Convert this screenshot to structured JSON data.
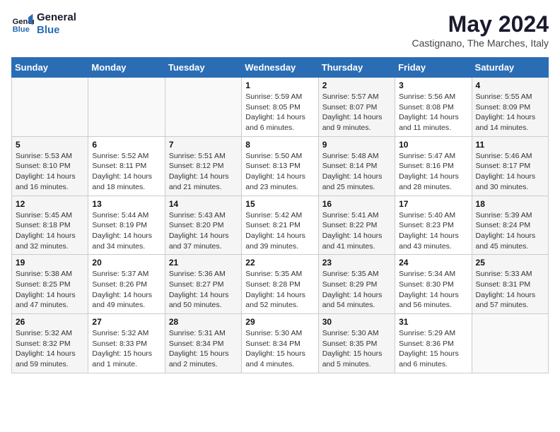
{
  "logo": {
    "line1": "General",
    "line2": "Blue"
  },
  "title": "May 2024",
  "subtitle": "Castignano, The Marches, Italy",
  "days_of_week": [
    "Sunday",
    "Monday",
    "Tuesday",
    "Wednesday",
    "Thursday",
    "Friday",
    "Saturday"
  ],
  "weeks": [
    [
      {
        "num": "",
        "info": ""
      },
      {
        "num": "",
        "info": ""
      },
      {
        "num": "",
        "info": ""
      },
      {
        "num": "1",
        "info": "Sunrise: 5:59 AM\nSunset: 8:05 PM\nDaylight: 14 hours\nand 6 minutes."
      },
      {
        "num": "2",
        "info": "Sunrise: 5:57 AM\nSunset: 8:07 PM\nDaylight: 14 hours\nand 9 minutes."
      },
      {
        "num": "3",
        "info": "Sunrise: 5:56 AM\nSunset: 8:08 PM\nDaylight: 14 hours\nand 11 minutes."
      },
      {
        "num": "4",
        "info": "Sunrise: 5:55 AM\nSunset: 8:09 PM\nDaylight: 14 hours\nand 14 minutes."
      }
    ],
    [
      {
        "num": "5",
        "info": "Sunrise: 5:53 AM\nSunset: 8:10 PM\nDaylight: 14 hours\nand 16 minutes."
      },
      {
        "num": "6",
        "info": "Sunrise: 5:52 AM\nSunset: 8:11 PM\nDaylight: 14 hours\nand 18 minutes."
      },
      {
        "num": "7",
        "info": "Sunrise: 5:51 AM\nSunset: 8:12 PM\nDaylight: 14 hours\nand 21 minutes."
      },
      {
        "num": "8",
        "info": "Sunrise: 5:50 AM\nSunset: 8:13 PM\nDaylight: 14 hours\nand 23 minutes."
      },
      {
        "num": "9",
        "info": "Sunrise: 5:48 AM\nSunset: 8:14 PM\nDaylight: 14 hours\nand 25 minutes."
      },
      {
        "num": "10",
        "info": "Sunrise: 5:47 AM\nSunset: 8:16 PM\nDaylight: 14 hours\nand 28 minutes."
      },
      {
        "num": "11",
        "info": "Sunrise: 5:46 AM\nSunset: 8:17 PM\nDaylight: 14 hours\nand 30 minutes."
      }
    ],
    [
      {
        "num": "12",
        "info": "Sunrise: 5:45 AM\nSunset: 8:18 PM\nDaylight: 14 hours\nand 32 minutes."
      },
      {
        "num": "13",
        "info": "Sunrise: 5:44 AM\nSunset: 8:19 PM\nDaylight: 14 hours\nand 34 minutes."
      },
      {
        "num": "14",
        "info": "Sunrise: 5:43 AM\nSunset: 8:20 PM\nDaylight: 14 hours\nand 37 minutes."
      },
      {
        "num": "15",
        "info": "Sunrise: 5:42 AM\nSunset: 8:21 PM\nDaylight: 14 hours\nand 39 minutes."
      },
      {
        "num": "16",
        "info": "Sunrise: 5:41 AM\nSunset: 8:22 PM\nDaylight: 14 hours\nand 41 minutes."
      },
      {
        "num": "17",
        "info": "Sunrise: 5:40 AM\nSunset: 8:23 PM\nDaylight: 14 hours\nand 43 minutes."
      },
      {
        "num": "18",
        "info": "Sunrise: 5:39 AM\nSunset: 8:24 PM\nDaylight: 14 hours\nand 45 minutes."
      }
    ],
    [
      {
        "num": "19",
        "info": "Sunrise: 5:38 AM\nSunset: 8:25 PM\nDaylight: 14 hours\nand 47 minutes."
      },
      {
        "num": "20",
        "info": "Sunrise: 5:37 AM\nSunset: 8:26 PM\nDaylight: 14 hours\nand 49 minutes."
      },
      {
        "num": "21",
        "info": "Sunrise: 5:36 AM\nSunset: 8:27 PM\nDaylight: 14 hours\nand 50 minutes."
      },
      {
        "num": "22",
        "info": "Sunrise: 5:35 AM\nSunset: 8:28 PM\nDaylight: 14 hours\nand 52 minutes."
      },
      {
        "num": "23",
        "info": "Sunrise: 5:35 AM\nSunset: 8:29 PM\nDaylight: 14 hours\nand 54 minutes."
      },
      {
        "num": "24",
        "info": "Sunrise: 5:34 AM\nSunset: 8:30 PM\nDaylight: 14 hours\nand 56 minutes."
      },
      {
        "num": "25",
        "info": "Sunrise: 5:33 AM\nSunset: 8:31 PM\nDaylight: 14 hours\nand 57 minutes."
      }
    ],
    [
      {
        "num": "26",
        "info": "Sunrise: 5:32 AM\nSunset: 8:32 PM\nDaylight: 14 hours\nand 59 minutes."
      },
      {
        "num": "27",
        "info": "Sunrise: 5:32 AM\nSunset: 8:33 PM\nDaylight: 15 hours\nand 1 minute."
      },
      {
        "num": "28",
        "info": "Sunrise: 5:31 AM\nSunset: 8:34 PM\nDaylight: 15 hours\nand 2 minutes."
      },
      {
        "num": "29",
        "info": "Sunrise: 5:30 AM\nSunset: 8:34 PM\nDaylight: 15 hours\nand 4 minutes."
      },
      {
        "num": "30",
        "info": "Sunrise: 5:30 AM\nSunset: 8:35 PM\nDaylight: 15 hours\nand 5 minutes."
      },
      {
        "num": "31",
        "info": "Sunrise: 5:29 AM\nSunset: 8:36 PM\nDaylight: 15 hours\nand 6 minutes."
      },
      {
        "num": "",
        "info": ""
      }
    ]
  ]
}
